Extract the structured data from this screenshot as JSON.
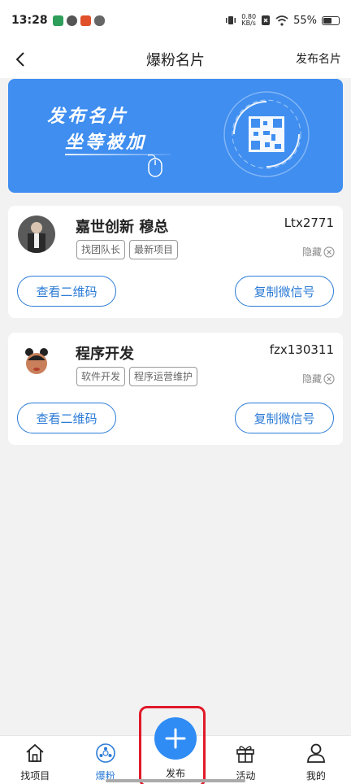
{
  "status_bar": {
    "time": "13:28",
    "net_speed_value": "0.80",
    "net_speed_unit": "KB/s",
    "battery": "55%"
  },
  "nav": {
    "title": "爆粉名片",
    "action": "发布名片",
    "back_icon": "chevron-left-icon"
  },
  "banner": {
    "line1": "发布名片",
    "line2": "坐等被加",
    "accent_color": "#3f8ef0"
  },
  "cards": [
    {
      "name": "嘉世创新 穆总",
      "id": "Ltx2771",
      "tags": [
        "找团队长",
        "最新项目"
      ],
      "hide_label": "隐藏",
      "btn_qr": "查看二维码",
      "btn_copy": "复制微信号"
    },
    {
      "name": "程序开发",
      "id": "fzx130311",
      "tags": [
        "软件开发",
        "程序运营维护"
      ],
      "hide_label": "隐藏",
      "btn_qr": "查看二维码",
      "btn_copy": "复制微信号"
    }
  ],
  "tabs": [
    {
      "label": "找项目",
      "icon": "home-icon",
      "active": false
    },
    {
      "label": "爆粉",
      "icon": "fans-icon",
      "active": true
    },
    {
      "label": "发布",
      "icon": "plus-icon",
      "active": false
    },
    {
      "label": "活动",
      "icon": "gift-icon",
      "active": false
    },
    {
      "label": "我的",
      "icon": "user-icon",
      "active": false
    }
  ],
  "colors": {
    "brand_blue": "#2b7bd6",
    "publish_blue": "#2f8cf4",
    "highlight_red": "#e01a2a"
  }
}
